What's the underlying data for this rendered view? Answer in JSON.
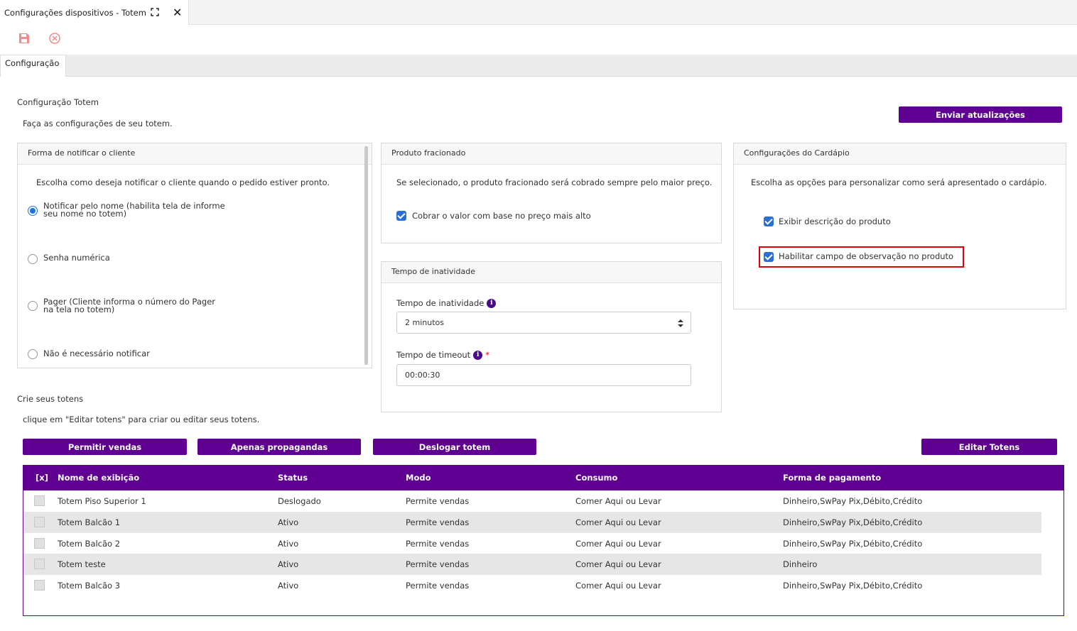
{
  "tab": {
    "title": "Configurações dispositivos - Totem"
  },
  "subtab": {
    "label": "Configuração"
  },
  "config": {
    "title": "Configuração Totem",
    "desc": "Faça as configurações de seu totem.",
    "send_button": "Enviar atualizações"
  },
  "notify": {
    "title": "Forma de notificar o cliente",
    "desc": "Escolha como deseja notificar o cliente quando o pedido estiver pronto.",
    "opt1_l1": "Notificar pelo nome (habilita tela de informe",
    "opt1_l2": "seu nome no totem)",
    "opt2": "Senha numérica",
    "opt3_l1": "Pager (Cliente informa o número do Pager",
    "opt3_l2": "na tela no totem)",
    "opt4": "Não é necessário notificar",
    "selected": "opt1"
  },
  "fracionado": {
    "title": "Produto fracionado",
    "desc": "Se selecionado, o produto fracionado será cobrado sempre pelo maior preço.",
    "check_label": "Cobrar o valor com base no preço mais alto",
    "checked": true
  },
  "inatividade": {
    "title": "Tempo de inatividade",
    "field1_label": "Tempo de inatividade",
    "field1_value": "2 minutos",
    "field2_label": "Tempo de timeout",
    "field2_value": "00:00:30",
    "required_mark": "*",
    "info_glyph": "i"
  },
  "cardapio": {
    "title": "Configurações do Cardápio",
    "desc": "Escolha as opções para personalizar como será apresentado o cardápio.",
    "opt1": "Exibir descrição do produto",
    "opt2": "Habilitar campo de observação no produto"
  },
  "totens": {
    "title": "Crie seus totens",
    "desc": "clique em \"Editar totens\" para criar ou editar seus totens.",
    "btn_vendas": "Permitir vendas",
    "btn_propagandas": "Apenas propagandas",
    "btn_deslogar": "Deslogar totem",
    "btn_editar": "Editar Totens"
  },
  "table": {
    "headers": {
      "select": "[x]",
      "nome": "Nome de exibição",
      "status": "Status",
      "modo": "Modo",
      "consumo": "Consumo",
      "pagamento": "Forma de pagamento"
    },
    "rows": [
      {
        "nome": "Totem Piso Superior 1",
        "status": "Deslogado",
        "modo": "Permite vendas",
        "consumo": "Comer Aqui ou Levar",
        "pagamento": "Dinheiro,SwPay Pix,Débito,Crédito"
      },
      {
        "nome": "Totem Balcão 1",
        "status": "Ativo",
        "modo": "Permite vendas",
        "consumo": "Comer Aqui ou Levar",
        "pagamento": "Dinheiro,SwPay Pix,Débito,Crédito"
      },
      {
        "nome": "Totem Balcão 2",
        "status": "Ativo",
        "modo": "Permite vendas",
        "consumo": "Comer Aqui ou Levar",
        "pagamento": "Dinheiro,SwPay Pix,Débito,Crédito"
      },
      {
        "nome": "Totem teste",
        "status": "Ativo",
        "modo": "Permite vendas",
        "consumo": "Comer Aqui ou Levar",
        "pagamento": "Dinheiro"
      },
      {
        "nome": "Totem Balcão 3",
        "status": "Ativo",
        "modo": "Permite vendas",
        "consumo": "Comer Aqui ou Levar",
        "pagamento": "Dinheiro,SwPay Pix,Débito,Crédito"
      }
    ]
  },
  "icons": {
    "save": "save-icon",
    "cancel": "cancel-icon",
    "expand": "expand-icon",
    "close": "close-icon",
    "select_arrows": "select-arrows-icon"
  },
  "colors": {
    "primary": "#5f0093",
    "checkbox": "#2a6fd6",
    "radio": "#1a73e8",
    "highlight": "#e00000",
    "toolbar_icon": "#f28b8b"
  }
}
